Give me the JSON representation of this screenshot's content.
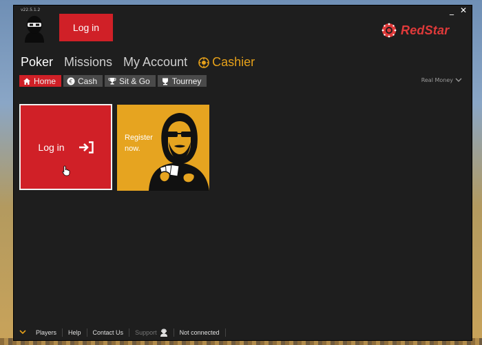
{
  "window": {
    "version": "v22.5.1.2",
    "minimize_label": "_",
    "close_label": "✕"
  },
  "header": {
    "login_label": "Log in",
    "brand_name": "RedStar",
    "brand_color": "#e03a3a"
  },
  "main_nav": {
    "items": [
      "Poker",
      "Missions",
      "My Account"
    ],
    "cashier_label": "Cashier",
    "cashier_color": "#e6a11a"
  },
  "sub_nav": {
    "items": [
      "Home",
      "Cash",
      "Sit & Go",
      "Tourney"
    ]
  },
  "real_money": {
    "label": "Real Money"
  },
  "tiles": {
    "login_label": "Log in",
    "register_label": "Register now."
  },
  "footer": {
    "items": [
      "Players",
      "Help",
      "Contact Us",
      "Support",
      "Not connected"
    ]
  },
  "colors": {
    "accent_red": "#d02027",
    "accent_orange": "#e6a420",
    "panel": "#1e1e1e"
  }
}
